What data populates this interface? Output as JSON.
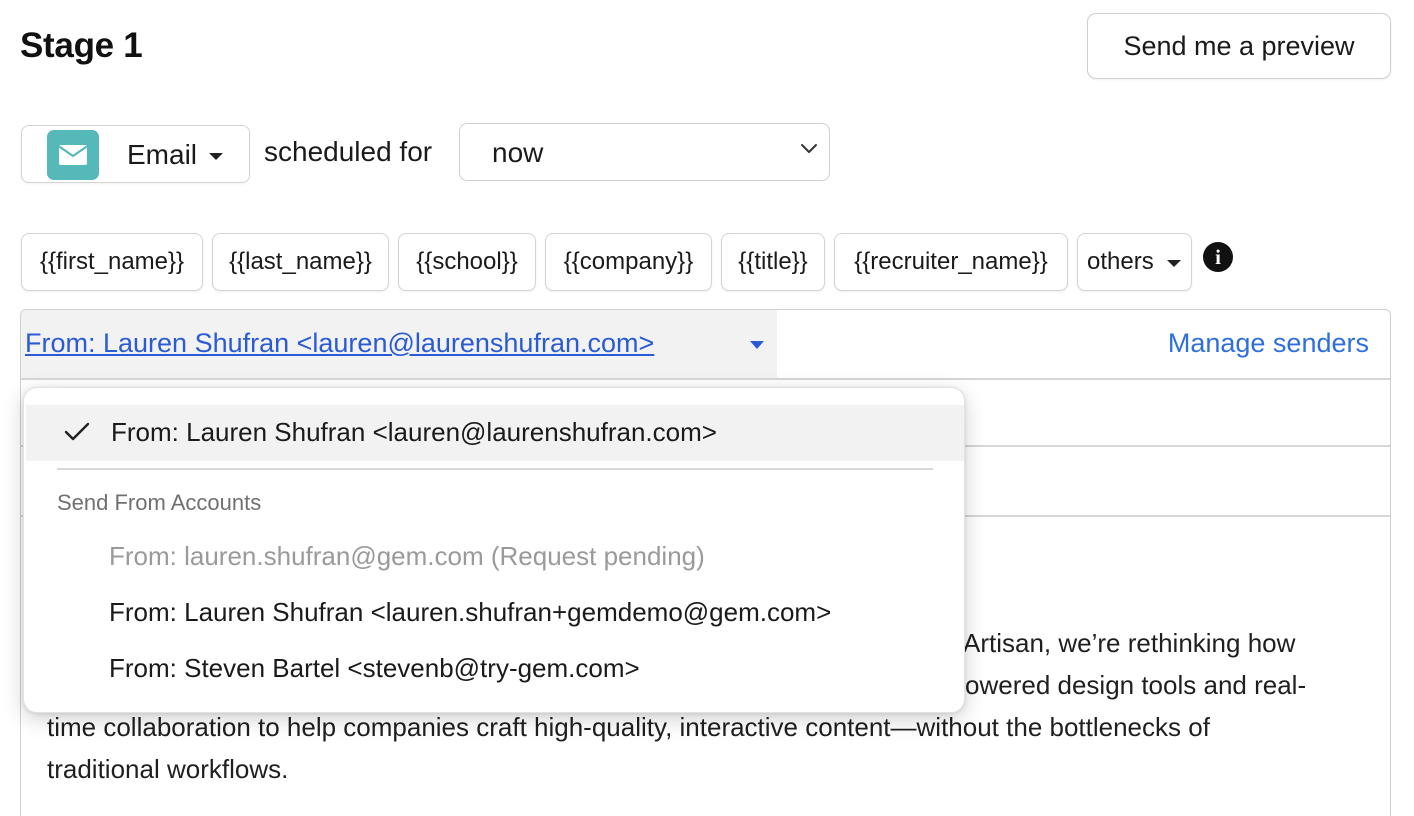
{
  "header": {
    "title": "Stage 1",
    "preview_button": "Send me a preview"
  },
  "schedule": {
    "channel": "Email",
    "channel_icon": "mail-icon",
    "scheduled_for_label": "scheduled for",
    "time_value": "now"
  },
  "tokens": {
    "items": [
      "{{first_name}}",
      "{{last_name}}",
      "{{school}}",
      "{{company}}",
      "{{title}}",
      "{{recruiter_name}}"
    ],
    "others_label": "others"
  },
  "composer": {
    "from_value": "From: Lauren Shufran <lauren@laurenshufran.com>",
    "manage_senders": "Manage senders",
    "body_lines": [
      "t Artisan, we’re rethinking how",
      "owered design tools and real-",
      "time collaboration to help companies craft high-quality, interactive content—without the bottlenecks of",
      "traditional workflows."
    ]
  },
  "sender_dropdown": {
    "selected": "From: Lauren Shufran <lauren@laurenshufran.com>",
    "section_label": "Send From Accounts",
    "accounts": [
      {
        "label": "From: lauren.shufran@gem.com (Request pending)",
        "disabled": true
      },
      {
        "label": "From: Lauren Shufran <lauren.shufran+gemdemo@gem.com>",
        "disabled": false
      },
      {
        "label": "From: Steven Bartel <stevenb@try-gem.com>",
        "disabled": false
      }
    ]
  },
  "colors": {
    "link_blue": "#2a5bd7",
    "email_icon_bg": "#55b8b9"
  }
}
